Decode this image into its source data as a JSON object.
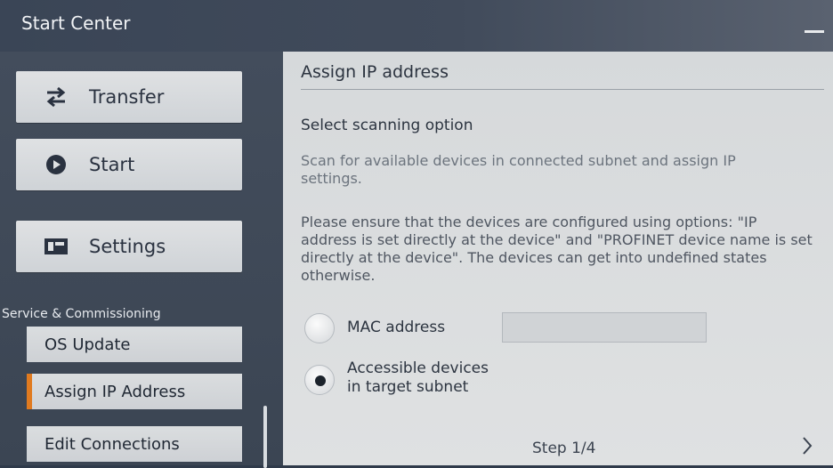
{
  "window": {
    "title": "Start Center"
  },
  "sidebar": {
    "main_buttons": [
      {
        "label": "Transfer",
        "icon": "transfer-arrows-icon"
      },
      {
        "label": "Start",
        "icon": "play-icon"
      },
      {
        "label": "Settings",
        "icon": "settings-icon"
      }
    ],
    "section_label": "Service & Commissioning",
    "sub_items": [
      {
        "label": "OS Update",
        "active": false
      },
      {
        "label": "Assign IP Address",
        "active": true
      },
      {
        "label": "Edit Connections",
        "active": false
      }
    ]
  },
  "main": {
    "heading": "Assign IP address",
    "subheading": "Select scanning option",
    "description": "Scan for available devices in connected subnet and assign IP settings.",
    "warning": "Please ensure that the devices are configured using options: \"IP address is set directly at the device\" and \"PROFINET device name is set directly at the device\". The devices can get into undefined states otherwise.",
    "options": [
      {
        "label": "MAC address",
        "selected": false
      },
      {
        "label_line1": "Accessible devices",
        "label_line2": "in target subnet",
        "selected": true
      }
    ],
    "mac_input_value": "",
    "step_label": "Step 1/4",
    "next_icon": "chevron-right-icon"
  },
  "colors": {
    "accent": "#e07a1f",
    "titlebar": "#3a4556",
    "panel": "#d6d9db"
  }
}
